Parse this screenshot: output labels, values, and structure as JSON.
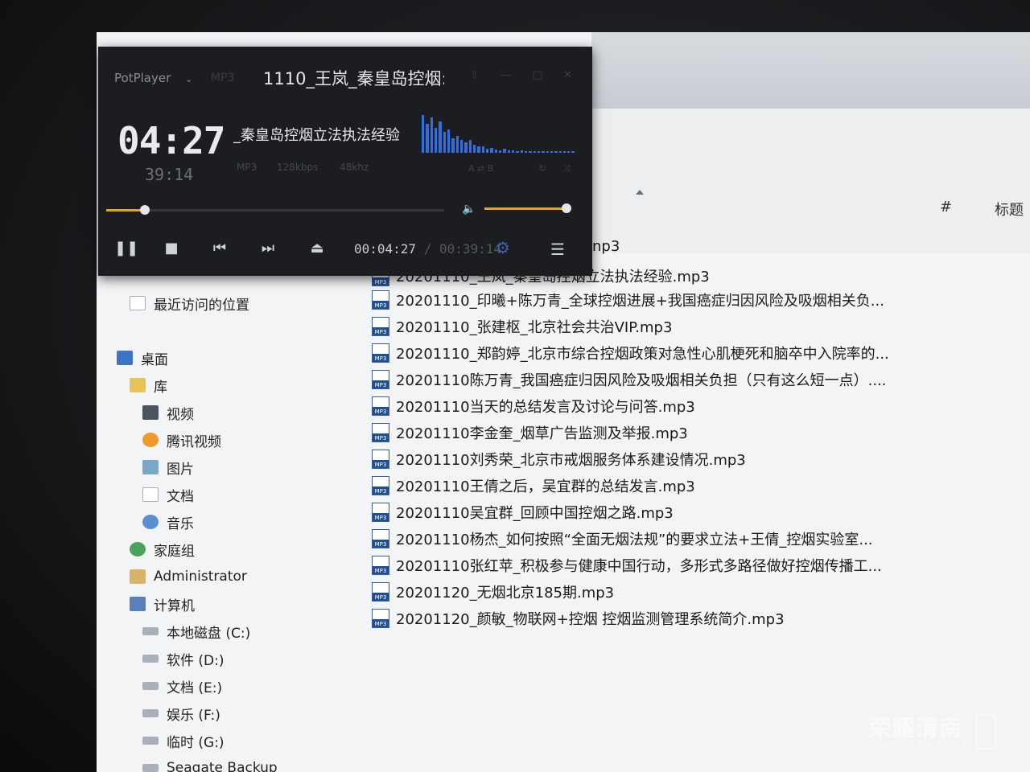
{
  "player": {
    "brand": "PotPlayer",
    "format_tag": "MP3",
    "title": "1110_王岚_秦皇岛控烟:",
    "track_title": "_秦皇岛控烟立法执法经验",
    "elapsed_big": "04:27",
    "total_small": "39:14",
    "meta": [
      "MP3",
      "128kbps",
      "48khz"
    ],
    "clock_elapsed": "00:04:27",
    "clock_total": "/ 00:39:14",
    "progress_fraction": 0.114,
    "volume_fraction": 1.0,
    "accent": "#e1a52c",
    "eq_color": "#2f6fe0",
    "eq_levels": [
      0.9,
      0.7,
      0.85,
      0.6,
      0.75,
      0.5,
      0.55,
      0.35,
      0.4,
      0.3,
      0.25,
      0.3,
      0.2,
      0.15,
      0.15,
      0.1,
      0.12,
      0.08,
      0.06,
      0.1,
      0.05,
      0.05,
      0.04,
      0.05,
      0.03,
      0.04,
      0.03,
      0.03,
      0.03,
      0.03,
      0.03,
      0.03,
      0.03,
      0.03,
      0.03,
      0.03
    ]
  },
  "explorer": {
    "col_hash": "#",
    "col_title": "标题",
    "partial_item": "np3",
    "first_row_partial": "20201110_王岚_秦皇岛控烟立法执法经验.mp3",
    "files": [
      "20201110_印曦+陈万青_全球控烟进展+我国癌症归因风险及吸烟相关负...",
      "20201110_张建枢_北京社会共治VIP.mp3",
      "20201110_郑韵婷_北京市综合控烟政策对急性心肌梗死和脑卒中入院率的...",
      "20201110陈万青_我国癌症归因风险及吸烟相关负担（只有这么短一点）....",
      "20201110当天的总结发言及讨论与问答.mp3",
      "20201110李金奎_烟草广告监测及举报.mp3",
      "20201110刘秀荣_北京市戒烟服务体系建设情况.mp3",
      "20201110王倩之后，吴宜群的总结发言.mp3",
      "20201110吴宜群_回顾中国控烟之路.mp3",
      "20201110杨杰_如何按照“全面无烟法规”的要求立法+王倩_控烟实验室...",
      "20201110张红苹_积极参与健康中国行动，多形式多路径做好控烟传播工...",
      "20201120_无烟北京185期.mp3",
      "20201120_颜敏_物联网+控烟 控烟监测管理系统简介.mp3"
    ],
    "nav": [
      {
        "label": "桌面",
        "icon": "desktop-icon",
        "indent": 1
      },
      {
        "label": "最近访问的位置",
        "icon": "recent-places-icon",
        "indent": 1
      },
      {
        "label": "",
        "icon": "",
        "indent": 0
      },
      {
        "label": "桌面",
        "icon": "desktop-icon",
        "indent": 0
      },
      {
        "label": "库",
        "icon": "library-icon",
        "indent": 1
      },
      {
        "label": "视频",
        "icon": "video-icon",
        "indent": 2
      },
      {
        "label": "腾讯视频",
        "icon": "tencent-video-icon",
        "indent": 2
      },
      {
        "label": "图片",
        "icon": "pictures-icon",
        "indent": 2
      },
      {
        "label": "文档",
        "icon": "documents-icon",
        "indent": 2
      },
      {
        "label": "音乐",
        "icon": "music-icon",
        "indent": 2
      },
      {
        "label": "家庭组",
        "icon": "homegroup-icon",
        "indent": 1
      },
      {
        "label": "Administrator",
        "icon": "user-icon",
        "indent": 1
      },
      {
        "label": "计算机",
        "icon": "computer-icon",
        "indent": 1
      },
      {
        "label": "本地磁盘 (C:)",
        "icon": "drive-icon",
        "indent": 2
      },
      {
        "label": "软件 (D:)",
        "icon": "drive-icon",
        "indent": 2
      },
      {
        "label": "文档 (E:)",
        "icon": "drive-icon",
        "indent": 2
      },
      {
        "label": "娱乐 (F:)",
        "icon": "drive-icon",
        "indent": 2
      },
      {
        "label": "临时 (G:)",
        "icon": "drive-icon",
        "indent": 2
      },
      {
        "label": "Seagate Backup",
        "icon": "drive-icon",
        "indent": 2
      }
    ]
  },
  "watermark": {
    "main": "荣耀渭南",
    "sub": "WWW.YEWN.CN",
    "app": "APP"
  }
}
